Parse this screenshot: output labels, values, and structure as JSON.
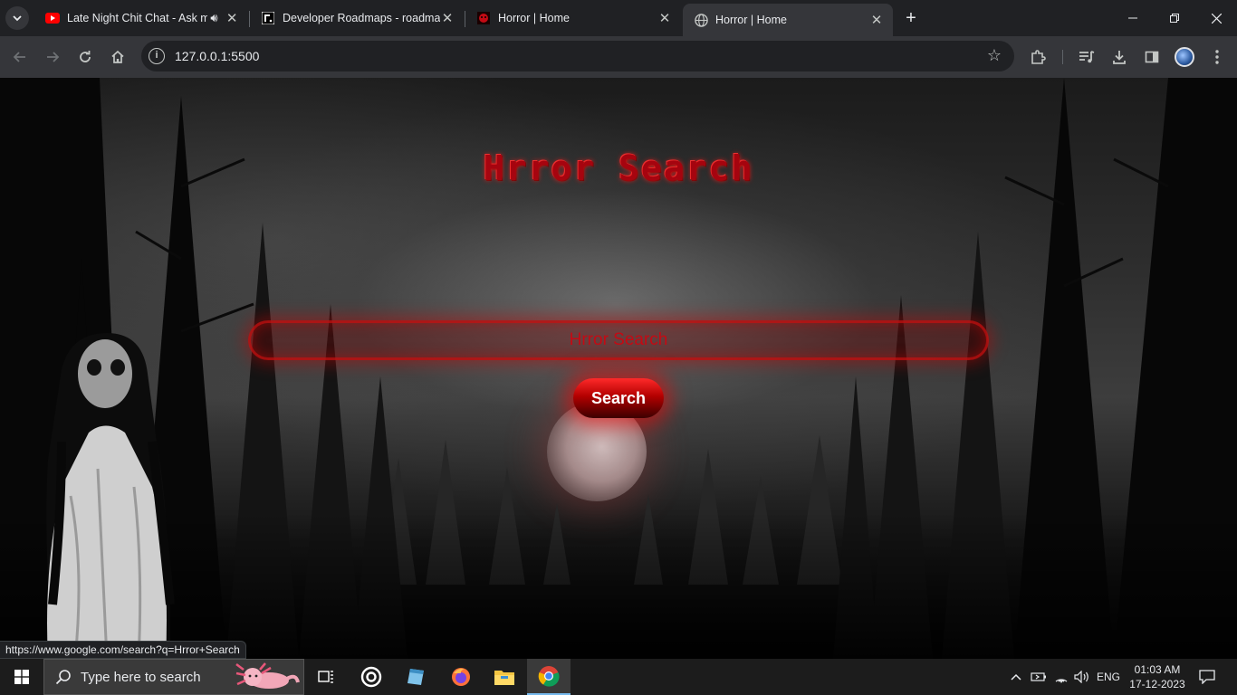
{
  "browser": {
    "tabs": [
      {
        "title": "Late Night Chit Chat - Ask m",
        "favicon": "youtube-icon",
        "audio": true,
        "active": false
      },
      {
        "title": "Developer Roadmaps - roadma",
        "favicon": "roadmap-icon",
        "active": false
      },
      {
        "title": "Horror | Home",
        "favicon": "horror-favicon",
        "active": false
      },
      {
        "title": "Horror | Home",
        "favicon": "globe-icon",
        "active": true
      }
    ],
    "url": "127.0.0.1:5500",
    "status_url": "https://www.google.com/search?q=Hrror+Search"
  },
  "page": {
    "title": "Hrror Search",
    "search_value": "Hrror Search",
    "search_button": "Search"
  },
  "taskbar": {
    "search_placeholder": "Type here to search",
    "language": "ENG",
    "time": "01:03 AM",
    "date": "17-12-2023"
  },
  "colors": {
    "accent_red": "#c40a14",
    "browser_dark": "#202124",
    "toolbar": "#35363a"
  }
}
